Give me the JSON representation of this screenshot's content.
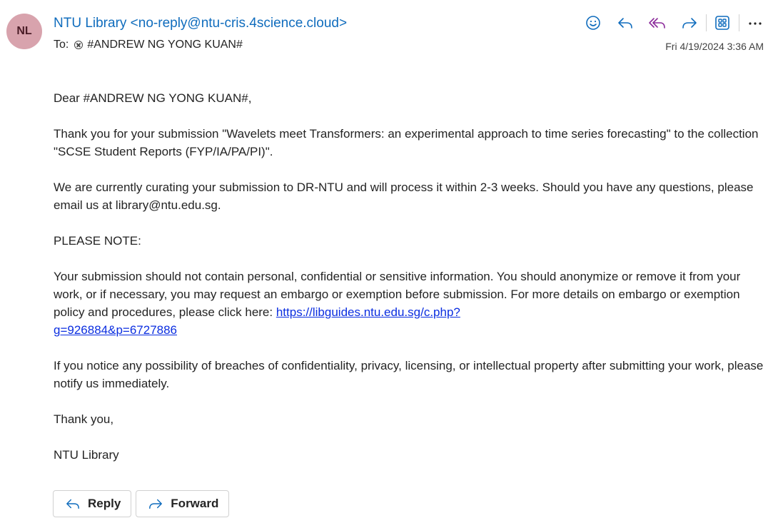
{
  "sender": {
    "initials": "NL",
    "display": "NTU Library <no-reply@ntu-cris.4science.cloud>"
  },
  "recipients": {
    "to_label": "To:",
    "to_name": "#ANDREW NG YONG KUAN#"
  },
  "date": "Fri 4/19/2024 3:36 AM",
  "toolbar": {
    "icons": [
      "emoji-icon",
      "reply-icon",
      "reply-all-icon",
      "forward-icon",
      "apps-icon",
      "more-icon"
    ],
    "accent": "#0f6cbd",
    "reply_all_color": "#8b2b9b"
  },
  "message": {
    "greeting": "Dear #ANDREW NG YONG KUAN#,",
    "para1": "Thank you for your submission \"Wavelets meet Transformers: an experimental approach to time series forecasting\" to the collection \"SCSE Student Reports (FYP/IA/PA/PI)\".",
    "para2": "We are currently curating your submission to DR-NTU and will process it within 2-3 weeks. Should you have any questions, please email us at library@ntu.edu.sg.",
    "note_heading": "PLEASE NOTE:",
    "para3_text": "Your submission should not contain personal, confidential or sensitive information. You should anonymize or remove it from your work, or if necessary, you may request an embargo or exemption before submission. For more details on embargo or exemption policy and procedures, please click here: ",
    "para3_link_line1": "https://libguides.ntu.edu.sg/c.php?",
    "para3_link_line2": "g=926884&p=6727886",
    "para4": "If you notice any possibility of breaches of confidentiality, privacy, licensing, or intellectual property after submitting your work, please notify us immediately.",
    "closing": "Thank you,",
    "signature": "NTU Library"
  },
  "actions": {
    "reply_label": "Reply",
    "forward_label": "Forward"
  }
}
